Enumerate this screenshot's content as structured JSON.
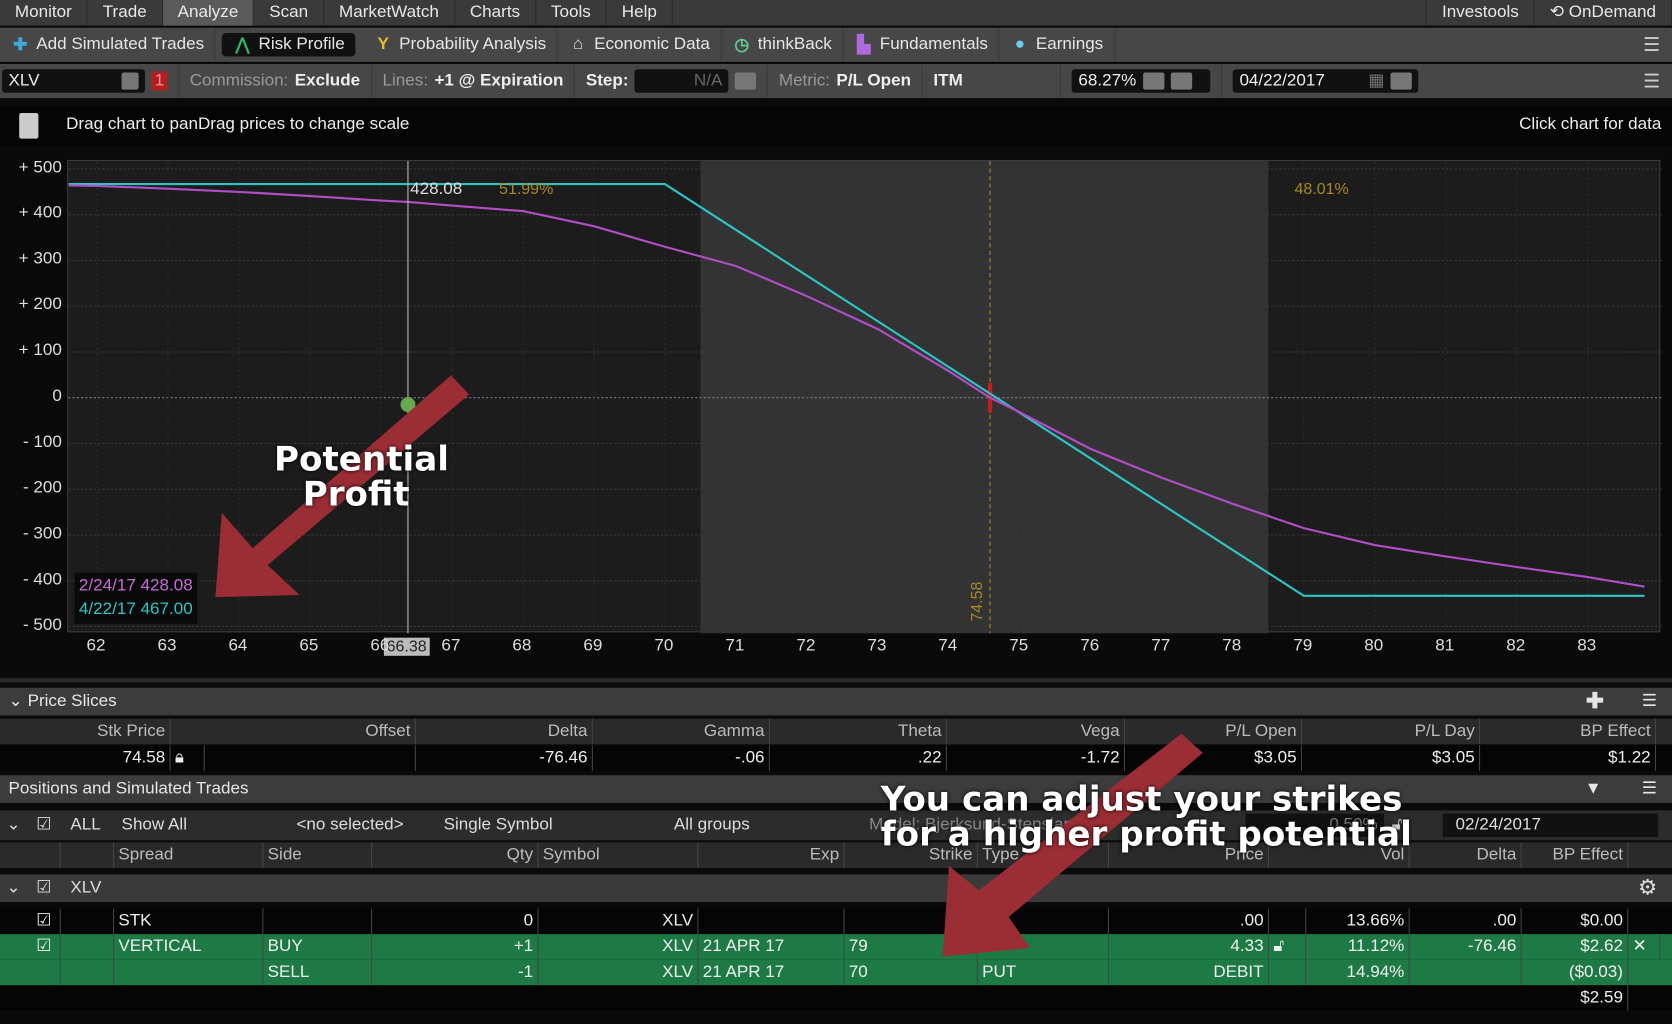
{
  "menu": {
    "items": [
      "Monitor",
      "Trade",
      "Analyze",
      "Scan",
      "MarketWatch",
      "Charts",
      "Tools",
      "Help"
    ],
    "active": "Analyze",
    "right": [
      "Investools",
      "OnDemand"
    ]
  },
  "toolbar": {
    "items": [
      {
        "label": "Add Simulated Trades",
        "icon": "plus-icon"
      },
      {
        "label": "Risk Profile",
        "icon": "risk-profile-icon"
      },
      {
        "label": "Probability Analysis",
        "icon": "probability-icon"
      },
      {
        "label": "Economic Data",
        "icon": "bank-icon"
      },
      {
        "label": "thinkBack",
        "icon": "clock-icon"
      },
      {
        "label": "Fundamentals",
        "icon": "blocks-icon"
      },
      {
        "label": "Earnings",
        "icon": "bulb-icon"
      }
    ],
    "active": "Risk Profile"
  },
  "controls": {
    "symbol": "XLV",
    "alert": "1",
    "commission_label": "Commission:",
    "commission": "Exclude",
    "lines_label": "Lines:",
    "lines": "+1 @ Expiration",
    "step_label": "Step:",
    "step": "N/A",
    "metric_label": "Metric:",
    "metric": "P/L Open",
    "itm": "ITM",
    "probability": "68.27%",
    "date": "04/22/2017"
  },
  "info": {
    "hint": "Drag chart to panDrag prices to change scale",
    "right": "Click chart for data"
  },
  "chart_data": {
    "type": "line",
    "xlim": [
      61.6,
      84.0
    ],
    "ylim": [
      -520,
      520
    ],
    "x_ticks": [
      "62",
      "63",
      "64",
      "65",
      "66",
      "67",
      "68",
      "69",
      "70",
      "71",
      "72",
      "73",
      "74",
      "75",
      "76",
      "77",
      "78",
      "79",
      "80",
      "81",
      "82",
      "83"
    ],
    "y_ticks": [
      "+ 500",
      "+ 400",
      "+ 300",
      "+ 200",
      "+ 100",
      "0",
      "- 100",
      "- 200",
      "- 300",
      "- 400",
      "- 500"
    ],
    "y_tick_values": [
      500,
      400,
      300,
      200,
      100,
      0,
      -100,
      -200,
      -300,
      -400,
      -500
    ],
    "grid": true,
    "series": [
      {
        "name": "4/22/17",
        "color": "#2ec4c4",
        "x": [
          61.6,
          70,
          79,
          83.8
        ],
        "y": [
          467,
          467,
          -433,
          -433
        ]
      },
      {
        "name": "2/24/17",
        "color": "#b04ec8",
        "x": [
          61.6,
          62,
          63,
          64,
          65,
          66,
          66.38,
          67,
          68,
          69,
          70,
          71,
          72,
          73,
          74,
          74.58,
          75,
          76,
          77,
          78,
          79,
          80,
          81,
          82,
          83,
          83.8
        ],
        "y": [
          464,
          463,
          457,
          450,
          441,
          431,
          428,
          420,
          408,
          375,
          330,
          288,
          222,
          150,
          58,
          0,
          -32,
          -112,
          -175,
          -232,
          -285,
          -322,
          -347,
          -370,
          -392,
          -413
        ]
      }
    ],
    "cursor_x": 66.38,
    "cursor_label": "66.38",
    "cursor_value": "428.08",
    "current_price": 74.58,
    "current_price_label": "74.58",
    "prob_left": "51.99%",
    "prob_right": "48.01%",
    "shaded_range": [
      70.5,
      78.5
    ],
    "legend": [
      {
        "text": "2/24/17 428.08",
        "color": "#c86ad8"
      },
      {
        "text": "4/22/17 467.00",
        "color": "#2ec4c4"
      }
    ]
  },
  "price_slices": {
    "title": "Price Slices",
    "headers": [
      "Stk Price",
      "Offset",
      "Delta",
      "Gamma",
      "Theta",
      "Vega",
      "P/L Open",
      "P/L Day",
      "BP Effect"
    ],
    "values": [
      "74.58",
      "",
      "-76.46",
      "-.06",
      ".22",
      "-1.72",
      "$3.05",
      "$3.05",
      "$1.22"
    ]
  },
  "positions": {
    "title": "Positions and Simulated Trades",
    "filters": {
      "all": "ALL",
      "show": "Show All",
      "selected": "<no selected>",
      "symbol_mode": "Single Symbol",
      "groups": "All groups",
      "model": "Model: Bjerksund-Stensland",
      "interest": "0.50%",
      "date": "02/24/2017"
    },
    "headers": [
      "Spread",
      "Side",
      "Qty",
      "Symbol",
      "Exp",
      "Strike",
      "Type",
      "Price",
      "Vol",
      "Delta",
      "BP Effect"
    ],
    "group": "XLV",
    "rows": [
      {
        "spread": "STK",
        "side": "",
        "qty": "0",
        "symbol": "XLV",
        "exp": "",
        "strike": "",
        "type": "",
        "price": ".00",
        "vol": "13.66%",
        "delta": ".00",
        "bp": "$0.00"
      },
      {
        "spread": "VERTICAL",
        "side": "BUY",
        "qty": "+1",
        "symbol": "XLV",
        "exp": "21 APR 17",
        "strike": "79",
        "type": "",
        "price": "4.33",
        "vol": "11.12%",
        "delta": "-76.46",
        "bp": "$2.62"
      },
      {
        "spread": "",
        "side": "SELL",
        "qty": "-1",
        "symbol": "XLV",
        "exp": "21 APR 17",
        "strike": "70",
        "type": "PUT",
        "price": "DEBIT",
        "vol": "14.94%",
        "delta": "",
        "bp": "($0.03)"
      }
    ],
    "total_bp": "$2.59"
  },
  "annotations": {
    "profit": [
      "Potential",
      "Profit"
    ],
    "strikes": [
      "You can adjust your strikes",
      "for a higher profit potential"
    ],
    "arrow_color": "#9b2d35"
  }
}
